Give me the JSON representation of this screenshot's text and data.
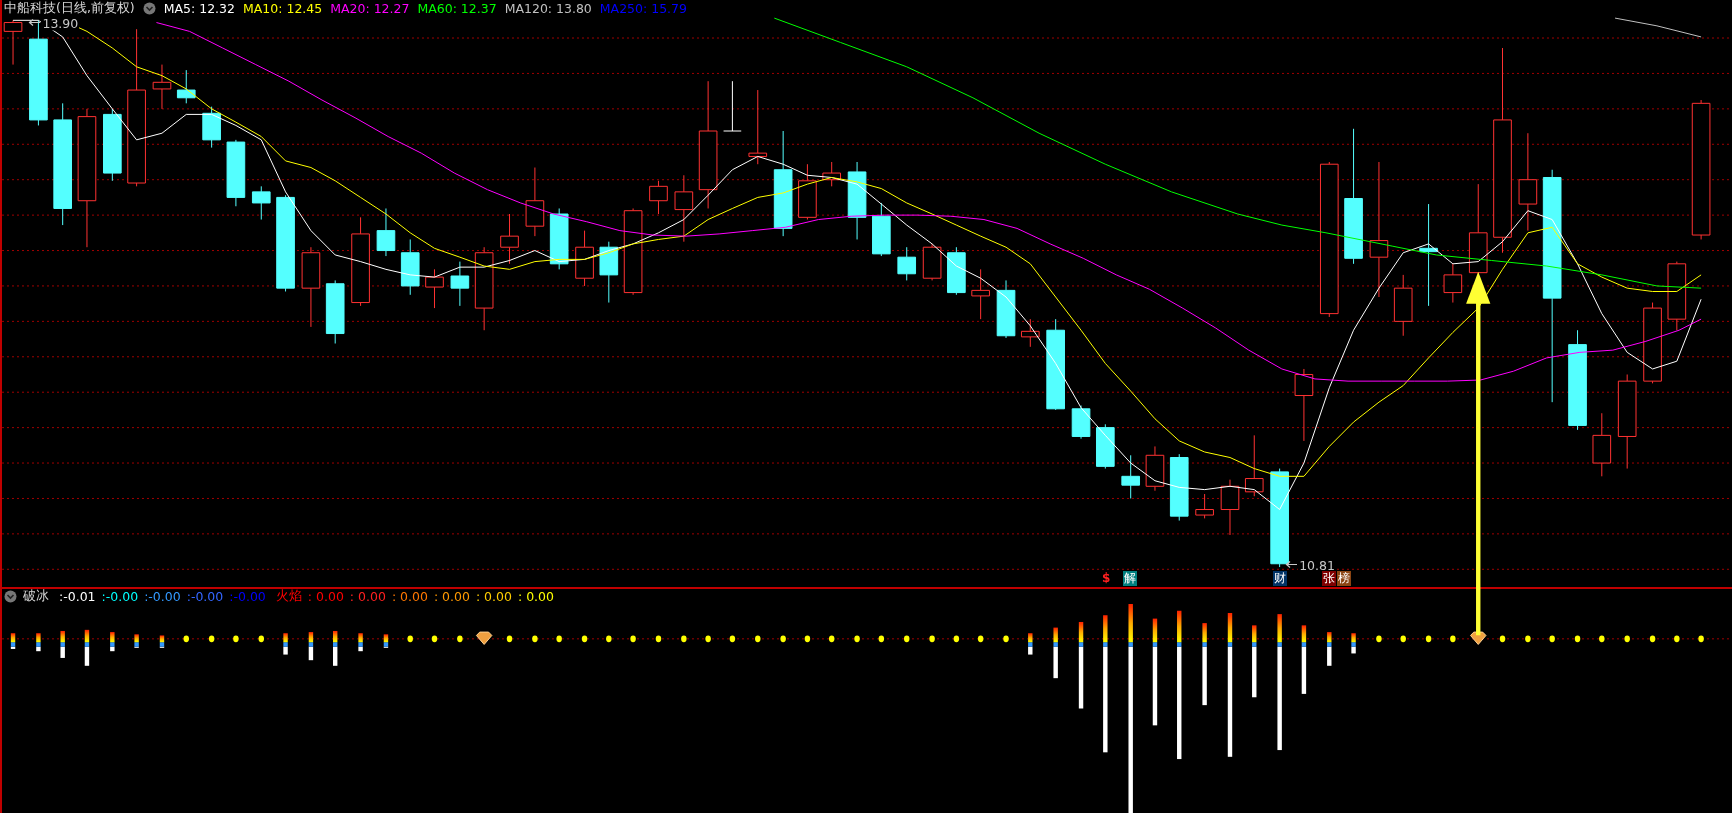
{
  "header": {
    "title": "中船科技(日线,前复权)",
    "moving_averages": [
      {
        "label": "MA5: 12.32",
        "color": "#ffffff"
      },
      {
        "label": "MA10: 12.45",
        "color": "#ffff00"
      },
      {
        "label": "MA20: 12.27",
        "color": "#ff00ff"
      },
      {
        "label": "MA60: 12.37",
        "color": "#00ff00"
      },
      {
        "label": "MA120: 13.80",
        "color": "#c0c0c0"
      },
      {
        "label": "MA250: 15.79",
        "color": "#0000ff"
      }
    ]
  },
  "price_marks": [
    {
      "kind": "high",
      "text": "13.90"
    },
    {
      "kind": "low",
      "text": "10.81"
    }
  ],
  "event_tags": [
    {
      "kind": "icon",
      "text": "$",
      "color": "#000000"
    },
    {
      "kind": "tag",
      "text": "解",
      "color": "#008080"
    },
    {
      "kind": "tag",
      "text": "财",
      "color": "#003366"
    },
    {
      "kind": "tag",
      "text": "张",
      "color": "#800000"
    },
    {
      "kind": "tag",
      "text": "榜",
      "color": "#8b4513"
    }
  ],
  "indicator": {
    "name": "破冰",
    "segments": [
      {
        "kind": "value",
        "text": ":-0.01",
        "color": "#ffffff"
      },
      {
        "kind": "value",
        "text": ":-0.00",
        "color": "#00ffff"
      },
      {
        "kind": "value",
        "text": ":-0.00",
        "color": "#3399ff"
      },
      {
        "kind": "value",
        "text": ":-0.00",
        "color": "#3366ff"
      },
      {
        "kind": "value",
        "text": ":-0.00",
        "color": "#0000ff"
      },
      {
        "kind": "label",
        "text": "火焰",
        "color": "#ff0000"
      },
      {
        "kind": "value",
        "text": ": 0.00",
        "color": "#ff0000"
      },
      {
        "kind": "value",
        "text": ": 0.00",
        "color": "#ff2020"
      },
      {
        "kind": "value",
        "text": ": 0.00",
        "color": "#ff7700"
      },
      {
        "kind": "value",
        "text": ": 0.00",
        "color": "#ff9900"
      },
      {
        "kind": "value",
        "text": ": 0.00",
        "color": "#ffcc00"
      },
      {
        "kind": "value",
        "text": ": 0.00",
        "color": "#ffff00"
      }
    ]
  }
}
